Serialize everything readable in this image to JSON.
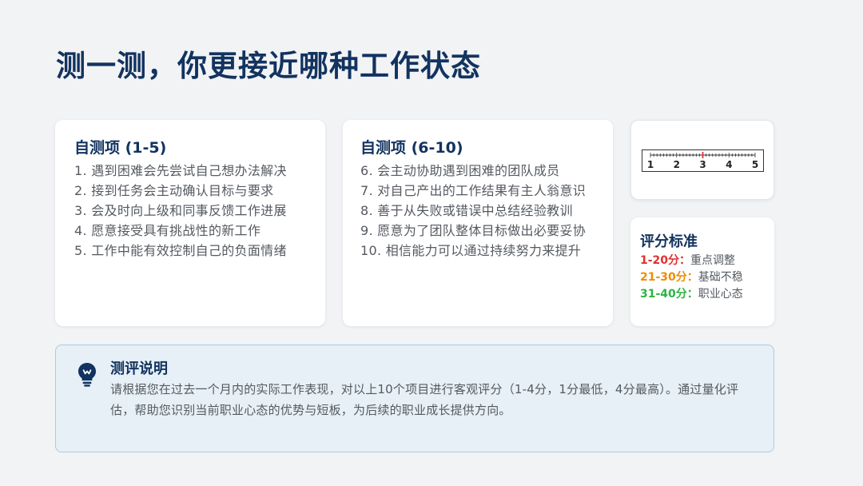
{
  "title": "测一测，你更接近哪种工作状态",
  "group1": {
    "heading": "自测项 (1-5)",
    "items": [
      "1. 遇到困难会先尝试自己想办法解决",
      "2. 接到任务会主动确认目标与要求",
      "3. 会及时向上级和同事反馈工作进展",
      "4. 愿意接受具有挑战性的新工作",
      "5. 工作中能有效控制自己的负面情绪"
    ]
  },
  "group2": {
    "heading": "自测项 (6-10)",
    "items": [
      "6. 会主动协助遇到困难的团队成员",
      "7. 对自己产出的工作结果有主人翁意识",
      "8. 善于从失败或错误中总结经验教训",
      "9. 愿意为了团队整体目标做出必要妥协",
      "10. 相信能力可以通过持续努力来提升"
    ]
  },
  "ruler": {
    "labels": [
      "1",
      "2",
      "3",
      "4",
      "5"
    ],
    "marker_value": 3,
    "marker_color": "#e03131"
  },
  "scoring": {
    "heading": "评分标准",
    "rows": [
      {
        "range": "1-20分：",
        "desc": "重点调整",
        "color": "#e03131"
      },
      {
        "range": "21-30分：",
        "desc": "基础不稳",
        "color": "#f08c00"
      },
      {
        "range": "31-40分：",
        "desc": "职业心态",
        "color": "#2fb344"
      }
    ]
  },
  "note": {
    "icon": "lightbulb-icon",
    "heading": "测评说明",
    "body": "请根据您在过去一个月内的实际工作表现，对以上10个项目进行客观评分（1-4分，1分最低，4分最高）。通过量化评估，帮助您识别当前职业心态的优势与短板，为后续的职业成长提供方向。"
  },
  "colors": {
    "title": "#12335f",
    "text": "#555a60",
    "note_bg": "#e6f0f6",
    "note_border": "#a9cde3"
  }
}
